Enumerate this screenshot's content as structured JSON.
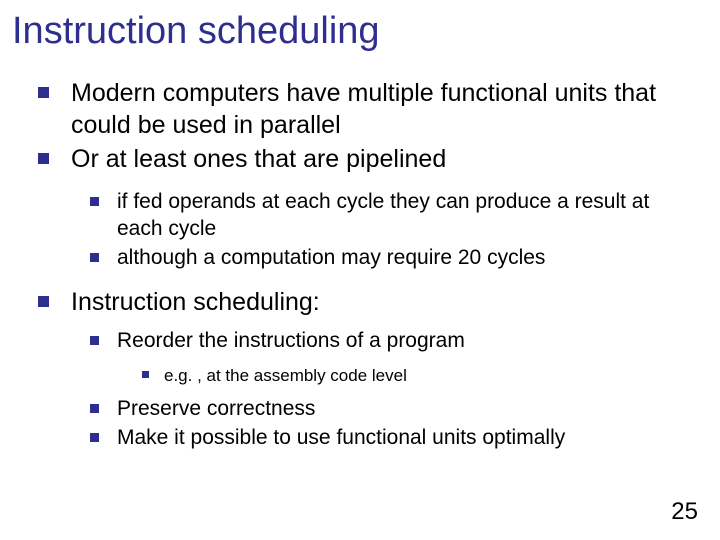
{
  "title": "Instruction scheduling",
  "bullets": {
    "b1": "Modern computers have multiple functional units that could be used in parallel",
    "b2": " Or at least ones that are pipelined",
    "b2_1": "if fed operands at each cycle they can produce a result at each cycle",
    "b2_2": "although a computation may require 20 cycles",
    "b3": "Instruction scheduling:",
    "b3_1": "Reorder the instructions of a program",
    "b3_1_1": "e.g. , at the assembly code level",
    "b3_2": "Preserve correctness",
    "b3_3": "Make it possible to use functional units optimally"
  },
  "pageNumber": "25"
}
